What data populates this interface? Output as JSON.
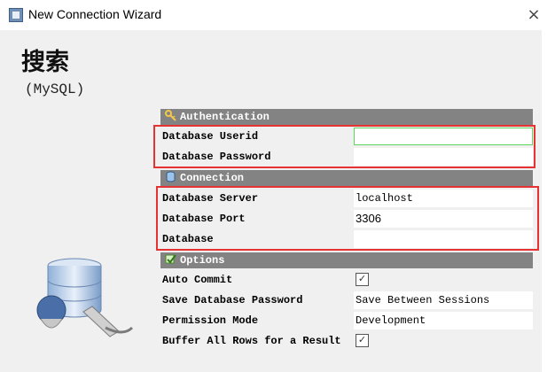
{
  "window": {
    "title": "New Connection Wizard",
    "close_glyph": "×"
  },
  "page": {
    "heading": "搜索",
    "subheading": "(MySQL)"
  },
  "sections": {
    "authentication": {
      "title": "Authentication",
      "icon": "key-icon"
    },
    "connection": {
      "title": "Connection",
      "icon": "database-icon"
    },
    "options": {
      "title": "Options",
      "icon": "checkmark-icon"
    }
  },
  "fields": {
    "userid": {
      "label": "Database Userid",
      "value": ""
    },
    "password": {
      "label": "Database Password",
      "value": ""
    },
    "server": {
      "label": "Database Server",
      "value": "localhost"
    },
    "port": {
      "label": "Database Port",
      "value": "3306"
    },
    "database": {
      "label": "Database",
      "value": ""
    },
    "auto_commit": {
      "label": "Auto Commit",
      "checked": true
    },
    "save_password": {
      "label": "Save Database Password",
      "value": "Save Between Sessions"
    },
    "permission_mode": {
      "label": "Permission Mode",
      "value": "Development"
    },
    "buffer_rows": {
      "label": "Buffer All Rows for a Result",
      "checked": true
    }
  },
  "colors": {
    "section_header": "#838383",
    "highlight": "#e53333",
    "focus": "#5ed65e"
  }
}
